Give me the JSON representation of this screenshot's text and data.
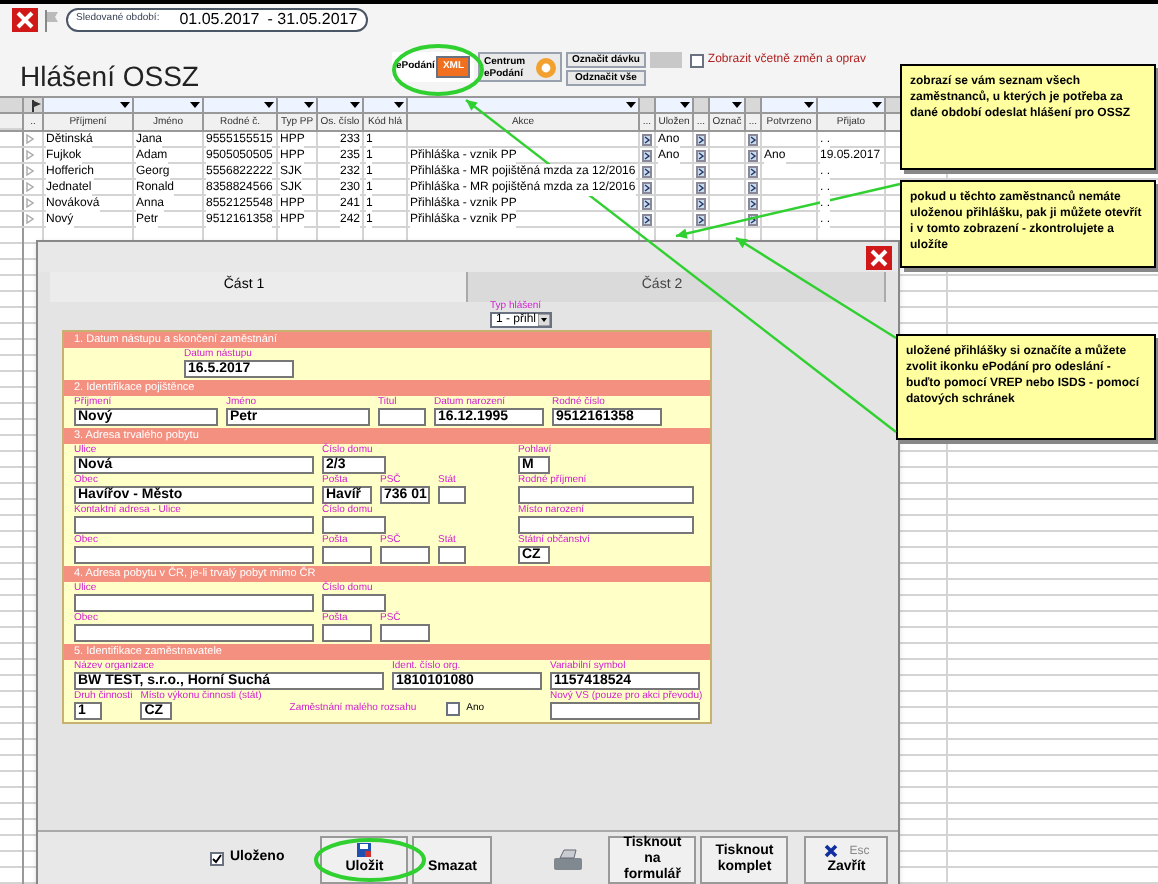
{
  "period": {
    "label": "Sledované období:",
    "from": "01.05.2017",
    "to": "- 31.05.2017"
  },
  "title": "Hlášení OSSZ",
  "toolbar": {
    "epodani": {
      "label": "ePodání",
      "badge": "XML"
    },
    "centrum": {
      "label": "Centrum ePodání"
    },
    "mark_batch": "Označit dávku",
    "unmark_all": "Odznačit vše",
    "show_changes": {
      "label": "Zobrazit včetně změn a oprav",
      "checked": false
    }
  },
  "table": {
    "columns": [
      {
        "label": "..",
        "kind": "marker",
        "filter": false
      },
      {
        "label": "Příjmení",
        "kind": "text",
        "filter": true
      },
      {
        "label": "Jméno",
        "kind": "text",
        "filter": true
      },
      {
        "label": "Rodné č.",
        "kind": "text",
        "filter": true
      },
      {
        "label": "Typ PP",
        "kind": "text",
        "filter": true
      },
      {
        "label": "Os. číslo",
        "kind": "num",
        "filter": true
      },
      {
        "label": "Kód hlá",
        "kind": "text",
        "filter": true
      },
      {
        "label": "Akce",
        "kind": "text",
        "filter": true
      },
      {
        "label": "...",
        "kind": "button",
        "filter": false
      },
      {
        "label": "Uložen",
        "kind": "text",
        "filter": true
      },
      {
        "label": "...",
        "kind": "button",
        "filter": false
      },
      {
        "label": "Označ",
        "kind": "text",
        "filter": true
      },
      {
        "label": "...",
        "kind": "button",
        "filter": false
      },
      {
        "label": "Potvrzeno",
        "kind": "text",
        "filter": true
      },
      {
        "label": "Přijato",
        "kind": "text",
        "filter": true
      }
    ],
    "rows": [
      {
        "surname": "Dětinská",
        "first_name": "Jana",
        "birth_number": "9555155515",
        "employment_type": "HPP",
        "employee_number": "233",
        "report_code": "1",
        "saved": "Ano",
        "received": ". ."
      },
      {
        "surname": "Fujkok",
        "first_name": "Adam",
        "birth_number": "9505050505",
        "employment_type": "HPP",
        "employee_number": "235",
        "report_code": "1",
        "action": "Přihláška - vznik PP",
        "saved": "Ano",
        "confirmed": "Ano",
        "received": "19.05.2017"
      },
      {
        "surname": "Hofferich",
        "first_name": "Georg",
        "birth_number": "5556822222",
        "employment_type": "SJK",
        "employee_number": "232",
        "report_code": "1",
        "action": "Přihláška - MR pojištěná mzda za 12/2016",
        "received": ". ."
      },
      {
        "surname": "Jednatel",
        "first_name": "Ronald",
        "birth_number": "8358824566",
        "employment_type": "SJK",
        "employee_number": "230",
        "report_code": "1",
        "action": "Přihláška - MR pojištěná mzda za 12/2016",
        "received": ". ."
      },
      {
        "surname": "Nováková",
        "first_name": "Anna",
        "birth_number": "8552125548",
        "employment_type": "HPP",
        "employee_number": "241",
        "report_code": "1",
        "action": "Přihláška - vznik PP",
        "received": ". ."
      },
      {
        "surname": "Nový",
        "first_name": "Petr",
        "birth_number": "9512161358",
        "employment_type": "HPP",
        "employee_number": "242",
        "report_code": "1",
        "action": "Přihláška - vznik PP",
        "received": ". ."
      }
    ]
  },
  "dialog": {
    "tabs": [
      {
        "label": "Část 1",
        "selected": true
      },
      {
        "label": "Část 2",
        "selected": false
      }
    ],
    "report_type": {
      "label": "Typ hlášení",
      "value": "1 - přihl"
    },
    "sections": [
      {
        "title": "1. Datum nástupu a skončení zaměstnání",
        "kind": "dates",
        "columns": [
          [
            [
              {
                "label": "Datum nástupu",
                "value": "16.5.2017"
              }
            ]
          ]
        ]
      },
      {
        "title": "2. Identifikace pojištěnce",
        "kind": "person",
        "columns": [
          [
            [
              {
                "label": "Příjmení",
                "value": "Nový"
              },
              {
                "label": "Jméno",
                "value": "Petr"
              },
              {
                "label": "Titul"
              },
              {
                "label": "Datum narození",
                "value": "16.12.1995"
              },
              {
                "label": "Rodné číslo",
                "value": "9512161358"
              }
            ]
          ]
        ]
      },
      {
        "title": "3. Adresa trvalého pobytu",
        "kind": "address",
        "columns": [
          [
            [
              {
                "label": "Ulice",
                "value": "Nová"
              },
              {
                "label": "Číslo domu",
                "value": "2/3"
              }
            ],
            [
              {
                "label": "Obec",
                "value": "Havířov - Město"
              },
              {
                "label": "Pošta",
                "value": "Havíř"
              },
              {
                "label": "PSČ",
                "value": "736 01"
              },
              {
                "label": "Stát"
              }
            ],
            [
              {
                "label": "Kontaktní adresa - Ulice"
              },
              {
                "label": "Číslo domu"
              }
            ],
            [
              {
                "label": "Obec"
              },
              {
                "label": "Pošta"
              },
              {
                "label": "PSČ"
              },
              {
                "label": "Stát"
              }
            ]
          ],
          [
            [
              {
                "label": "Pohlaví",
                "value": "M"
              }
            ],
            [
              {
                "label": "Rodné příjmení"
              }
            ],
            [
              {
                "label": "Místo narození"
              }
            ],
            [
              {
                "label": "Státní občanství",
                "value": "CZ"
              }
            ]
          ]
        ]
      },
      {
        "title": "4. Adresa pobytu v ČR, je-li trvalý pobyt mimo ČR",
        "kind": "address",
        "columns": [
          [
            [
              {
                "label": "Ulice"
              },
              {
                "label": "Číslo domu"
              }
            ],
            [
              {
                "label": "Obec"
              },
              {
                "label": "Pošta"
              },
              {
                "label": "PSČ"
              }
            ]
          ]
        ]
      },
      {
        "title": "5. Identifikace zaměstnavatele",
        "kind": "employer",
        "columns": [
          [
            [
              {
                "label": "Název organizace",
                "value": "BW TEST, s.r.o., Horní Suchá"
              },
              {
                "label": "Ident. číslo org.",
                "value": "1810101080"
              }
            ],
            [
              {
                "label": "Druh činnosti",
                "value": "1"
              },
              {
                "label": "Místo výkonu činnosti (stát)",
                "value": "CZ"
              },
              {
                "kind": "checkbox",
                "label": "Zaměstnání malého rozsahu",
                "option": "Ano",
                "checked": false
              }
            ]
          ],
          [
            [
              {
                "label": "Variabilní symbol",
                "value": "1157418524"
              }
            ],
            [
              {
                "label": "Nový VS (pouze pro akci převodu)"
              }
            ]
          ]
        ]
      }
    ],
    "saved": {
      "label": "Uloženo",
      "checked": true
    },
    "buttons": [
      {
        "kind": "save",
        "label": "Uložit"
      },
      {
        "kind": "delete",
        "label": "Smazat"
      },
      {
        "kind": "print"
      },
      {
        "kind": "text",
        "label": "Tisknout na formulář"
      },
      {
        "kind": "text",
        "label": "Tisknout komplet"
      },
      {
        "kind": "close",
        "key": "Esc",
        "label": "Zavřít"
      }
    ]
  },
  "callouts": [
    {
      "text": "zobrazí se vám seznam všech zaměstnanců, u kterých je potřeba za dané období odeslat hlášení pro OSSZ"
    },
    {
      "text": "pokud u těchto zaměstnanců nemáte uloženou přihlášku, pak ji můžete otevřít i v tomto zobrazení - zkontrolujete a uložíte"
    },
    {
      "text": "uložené přihlášky si označíte a můžete zvolit ikonku ePodání pro odeslání - buďto pomocí VREP nebo ISDS - pomocí datových schránek"
    }
  ]
}
